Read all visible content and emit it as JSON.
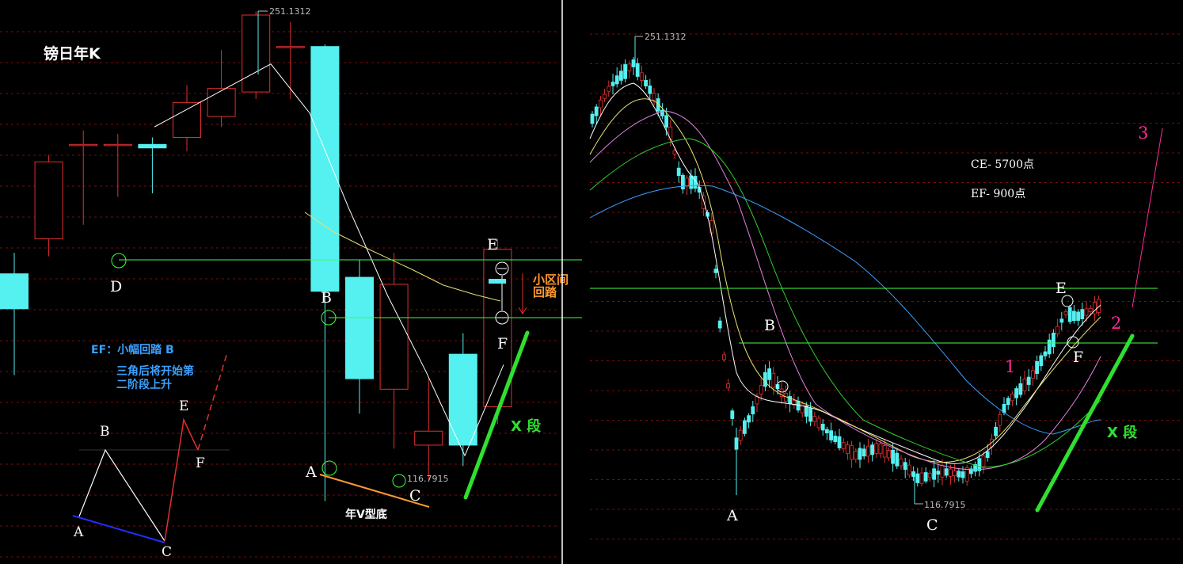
{
  "chart_data": [
    {
      "type": "candlestick",
      "title": "镑日年K",
      "price_label_high": "251.1312",
      "price_label_low": "116.7915",
      "candles": [
        {
          "open": 176,
          "close": 166,
          "high": 182,
          "low": 147
        },
        {
          "open": 186,
          "close": 208,
          "high": 210,
          "low": 181
        },
        {
          "open": 213,
          "close": 213,
          "high": 217,
          "low": 190
        },
        {
          "open": 213,
          "close": 213,
          "high": 216,
          "low": 198
        },
        {
          "open": 213,
          "close": 212,
          "high": 215,
          "low": 199
        },
        {
          "open": 215,
          "close": 225,
          "high": 230,
          "low": 211
        },
        {
          "open": 221,
          "close": 229,
          "high": 240,
          "low": 218
        },
        {
          "open": 228,
          "close": 250,
          "high": 251,
          "low": 226
        },
        {
          "open": 241,
          "close": 241,
          "high": 248,
          "low": 226
        },
        {
          "open": 241,
          "close": 171,
          "high": 241.6,
          "low": 111
        },
        {
          "open": 175,
          "close": 146,
          "high": 180,
          "low": 136
        },
        {
          "open": 143,
          "close": 173,
          "high": 182,
          "low": 126
        },
        {
          "open": 127,
          "close": 131,
          "high": 146,
          "low": 117
        },
        {
          "open": 153,
          "close": 127,
          "high": 159,
          "low": 121
        },
        {
          "open": 138,
          "close": 183,
          "high": 186,
          "low": 133
        }
      ],
      "ma_line": [
        218,
        224,
        230,
        236,
        222,
        195,
        170,
        148,
        124,
        150
      ]
    },
    {
      "type": "line",
      "price_label_high": "251.1312",
      "price_label_low": "116.7915"
    }
  ],
  "left": {
    "points": {
      "d": "D",
      "b": "B",
      "e": "E",
      "f": "F",
      "a": "A",
      "c": "C"
    },
    "pullback_label": "小区间\n回踏",
    "x_segment_label": "X 段",
    "v_bottom_label": "年V型底",
    "ef_note_line1": "EF：小幅回踏 B",
    "ef_note_line2": "三角后将开始第",
    "ef_note_line3": "二阶段上升",
    "diagram": {
      "b": "B",
      "e": "E",
      "f": "F",
      "a": "A",
      "c": "C"
    }
  },
  "right": {
    "points": {
      "a": "A",
      "b": "B",
      "c": "C",
      "e": "E",
      "f": "F"
    },
    "ce_note": "CE- 5700点",
    "ef_note": "EF- 900点",
    "wave_1": "1",
    "wave_2": "2",
    "wave_3": "3",
    "x_segment_label": "X 段"
  },
  "colors": {
    "up_candle": "#e03030",
    "down_candle": "#55f0f0",
    "grid": "#7a0d0d",
    "support_line": "#40ff40",
    "x_segment": "#30e030",
    "orange": "#ff9a30",
    "pink": "#ff2a9a",
    "blue_note": "#3aa0ff"
  }
}
